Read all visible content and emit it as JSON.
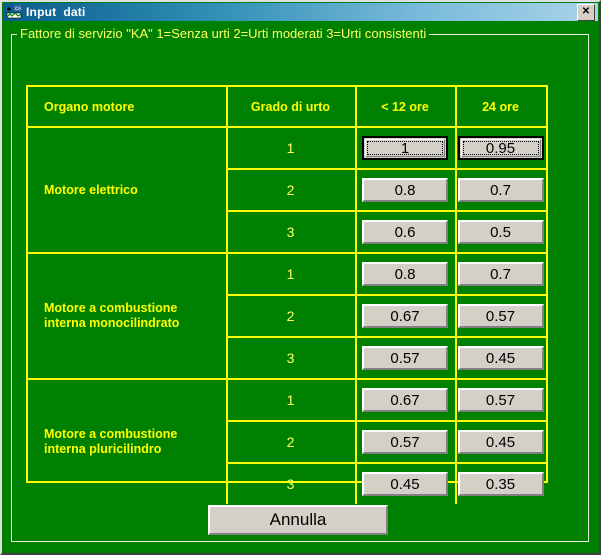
{
  "window": {
    "title": "Input  dati",
    "icon": "app-icon",
    "close_label": "✕",
    "background_color": "#008000"
  },
  "groupbox": {
    "legend": "Fattore di servizio \"KA\"  1=Senza urti 2=Urti moderati 3=Urti consistenti"
  },
  "table": {
    "headers": [
      "Organo motore",
      "Grado di urto",
      "< 12 ore",
      "24 ore"
    ],
    "groups": [
      {
        "name": "Motore elettrico",
        "rows": [
          {
            "grade": "1",
            "lt12": "1",
            "h24": "0.95",
            "focused": true
          },
          {
            "grade": "2",
            "lt12": "0.8",
            "h24": "0.7",
            "focused": false
          },
          {
            "grade": "3",
            "lt12": "0.6",
            "h24": "0.5",
            "focused": false
          }
        ]
      },
      {
        "name": "Motore a combustione\ninterna monocilindrato",
        "rows": [
          {
            "grade": "1",
            "lt12": "0.8",
            "h24": "0.7",
            "focused": false
          },
          {
            "grade": "2",
            "lt12": "0.67",
            "h24": "0.57",
            "focused": false
          },
          {
            "grade": "3",
            "lt12": "0.57",
            "h24": "0.45",
            "focused": false
          }
        ]
      },
      {
        "name": "Motore a combustione\ninterna pluricilindro",
        "rows": [
          {
            "grade": "1",
            "lt12": "0.67",
            "h24": "0.57",
            "focused": false
          },
          {
            "grade": "2",
            "lt12": "0.57",
            "h24": "0.45",
            "focused": false
          },
          {
            "grade": "3",
            "lt12": "0.45",
            "h24": "0.35",
            "focused": false
          }
        ]
      }
    ]
  },
  "footer": {
    "cancel_label": "Annulla"
  },
  "colors": {
    "window_bg": "#008000",
    "grid": "#ffff00",
    "label_text": "#ffff00",
    "button_face": "#d4d0c8",
    "title_text": "#ffffff"
  }
}
